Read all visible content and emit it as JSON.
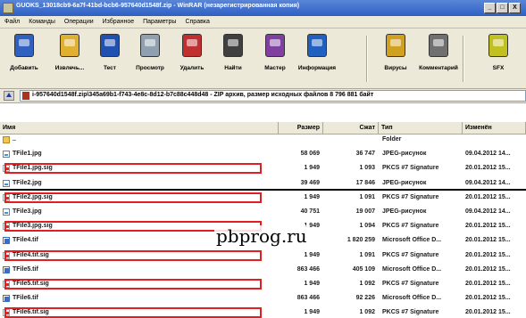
{
  "window": {
    "title": "GUOKS_13018cb9-6a7f-41bd-bcb6-957640d1548f.zip - WinRAR (незарегистрированная копия)",
    "controls": [
      "_",
      "□",
      "X"
    ]
  },
  "menu": [
    "Файл",
    "Команды",
    "Операции",
    "Избранное",
    "Параметры",
    "Справка"
  ],
  "toolbar": [
    {
      "label": "Добавить",
      "icon": "add-icon",
      "color": "#3060c0"
    },
    {
      "label": "Извлечь...",
      "icon": "extract-icon",
      "color": "#e0b030"
    },
    {
      "label": "Тест",
      "icon": "test-icon",
      "color": "#2050b0"
    },
    {
      "label": "Просмотр",
      "icon": "view-icon",
      "color": "#90a0b0"
    },
    {
      "label": "Удалить",
      "icon": "delete-icon",
      "color": "#c03030"
    },
    {
      "label": "Найти",
      "icon": "find-icon",
      "color": "#404040"
    },
    {
      "label": "Мастер",
      "icon": "wizard-icon",
      "color": "#8040a0"
    },
    {
      "label": "Информация",
      "icon": "info-icon",
      "color": "#2060c0"
    },
    {
      "label": "Вирусы",
      "icon": "virus-icon",
      "color": "#d0a020"
    },
    {
      "label": "Комментарий",
      "icon": "comment-icon",
      "color": "#707070"
    },
    {
      "label": "SFX",
      "icon": "sfx-icon",
      "color": "#c0c020"
    }
  ],
  "path": "i-957640d1548f.zip\\345a69b1-f743-4e8c-8d12-b7c88c448d48 - ZIP архив, размер исходных файлов 8 796 881 байт",
  "headers": [
    "Имя",
    "Размер",
    "Сжат",
    "Тип",
    "Изменён"
  ],
  "rows": [
    {
      "name": "..",
      "size": "",
      "packed": "",
      "type": "Folder",
      "modified": "",
      "icon": "folder",
      "hl": false
    },
    {
      "name": "TFile1.jpg",
      "size": "58 069",
      "packed": "36 747",
      "type": "JPEG-рисунок",
      "modified": "09.04.2012 14...",
      "icon": "jpg",
      "hl": false
    },
    {
      "name": "TFile1.jpg.sig",
      "size": "1 949",
      "packed": "1 093",
      "type": "PKCS #7 Signature",
      "modified": "20.01.2012 15...",
      "icon": "sig",
      "hl": true
    },
    {
      "name": "TFile2.jpg",
      "size": "39 469",
      "packed": "17 846",
      "type": "JPEG-рисунок",
      "modified": "09.04.2012 14...",
      "icon": "jpg",
      "hl": false
    },
    {
      "name": "TFile2.jpg.sig",
      "size": "1 949",
      "packed": "1 091",
      "type": "PKCS #7 Signature",
      "modified": "20.01.2012 15...",
      "icon": "sig",
      "hl": true
    },
    {
      "name": "TFile3.jpg",
      "size": "40 751",
      "packed": "19 007",
      "type": "JPEG-рисунок",
      "modified": "09.04.2012 14...",
      "icon": "jpg",
      "hl": false
    },
    {
      "name": "TFile3.jpg.sig",
      "size": "1 949",
      "packed": "1 094",
      "type": "PKCS #7 Signature",
      "modified": "20.01.2012 15...",
      "icon": "sig",
      "hl": true
    },
    {
      "name": "TFile4.tif",
      "size": "",
      "packed": "1 820 259",
      "type": "Microsoft Office D...",
      "modified": "20.01.2012 15...",
      "icon": "tif",
      "hl": false
    },
    {
      "name": "TFile4.tif.sig",
      "size": "1 949",
      "packed": "1 091",
      "type": "PKCS #7 Signature",
      "modified": "20.01.2012 15...",
      "icon": "sig",
      "hl": true
    },
    {
      "name": "TFile5.tif",
      "size": "863 466",
      "packed": "405 109",
      "type": "Microsoft Office D...",
      "modified": "20.01.2012 15...",
      "icon": "tif",
      "hl": false
    },
    {
      "name": "TFile5.tif.sig",
      "size": "1 949",
      "packed": "1 092",
      "type": "PKCS #7 Signature",
      "modified": "20.01.2012 15...",
      "icon": "sig",
      "hl": true
    },
    {
      "name": "TFile6.tif",
      "size": "863 466",
      "packed": "92 226",
      "type": "Microsoft Office D...",
      "modified": "20.01.2012 15...",
      "icon": "tif",
      "hl": false
    },
    {
      "name": "TFile6.tif.sig",
      "size": "1 949",
      "packed": "1 092",
      "type": "PKCS #7 Signature",
      "modified": "20.01.2012 15...",
      "icon": "sig",
      "hl": true
    }
  ],
  "watermark": "pbprog.ru",
  "fragment": "c"
}
